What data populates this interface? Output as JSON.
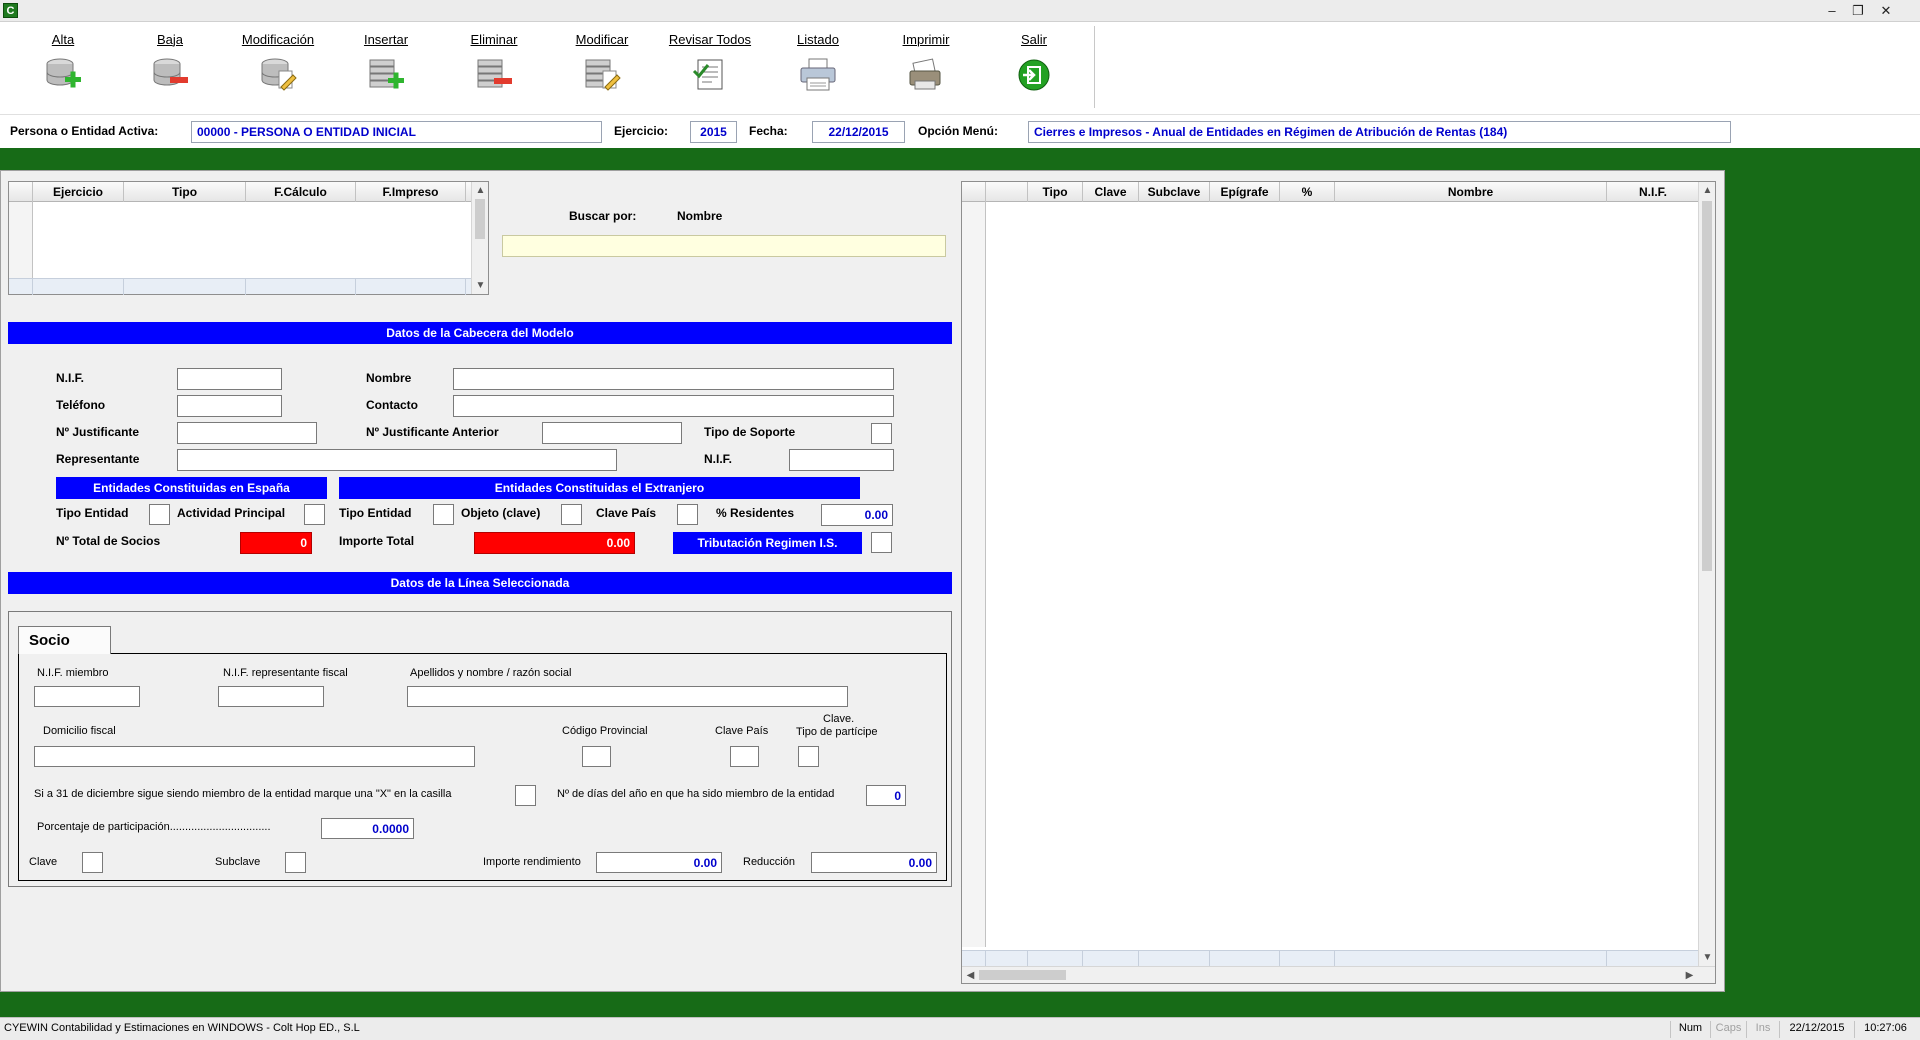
{
  "window": {
    "icon_letter": "C"
  },
  "toolbar": {
    "items": [
      {
        "label": "Alta",
        "icon": "db-add-icon"
      },
      {
        "label": "Baja",
        "icon": "db-remove-icon"
      },
      {
        "label": "Modificación",
        "icon": "db-edit-icon"
      },
      {
        "label": "Insertar",
        "icon": "stack-add-icon"
      },
      {
        "label": "Eliminar",
        "icon": "stack-remove-icon"
      },
      {
        "label": "Modificar",
        "icon": "stack-edit-icon"
      },
      {
        "label": "Revisar Todos",
        "icon": "review-icon"
      },
      {
        "label": "Listado",
        "icon": "printer-icon"
      },
      {
        "label": "Imprimir",
        "icon": "print-job-icon"
      },
      {
        "label": "Salir",
        "icon": "exit-icon"
      }
    ]
  },
  "active": {
    "persona_label": "Persona o Entidad Activa:",
    "persona_value": "00000 - PERSONA O ENTIDAD INICIAL",
    "ejercicio_label": "Ejercicio:",
    "ejercicio_value": "2015",
    "fecha_label": "Fecha:",
    "fecha_value": "22/12/2015",
    "opcion_label": "Opción Menú:",
    "opcion_value": "Cierres e Impresos - Anual de Entidades en Régimen de Atribución de Rentas (184)"
  },
  "left_grid": {
    "columns": [
      "Ejercicio",
      "Tipo",
      "F.Cálculo",
      "F.Impreso"
    ]
  },
  "search": {
    "label": "Buscar por:",
    "field_name": "Nombre",
    "value": ""
  },
  "right_grid": {
    "columns": [
      "Tipo",
      "Clave",
      "Subclave",
      "Epígrafe",
      "%",
      "Nombre",
      "N.I.F."
    ]
  },
  "cabecera": {
    "title": "Datos de la Cabecera del Modelo",
    "nif_label": "N.I.F.",
    "telefono_label": "Teléfono",
    "justificante_label": "Nº Justificante",
    "representante_label": "Representante",
    "nombre_label": "Nombre",
    "contacto_label": "Contacto",
    "justificante_ant_label": "Nº Justificante Anterior",
    "soporte_label": "Tipo de Soporte",
    "rep_nif_label": "N.I.F.",
    "espana_title": "Entidades Constituidas en España",
    "extranjero_title": "Entidades Constituidas el Extranjero",
    "tipo_entidad_label": "Tipo Entidad",
    "actividad_label": "Actividad Principal",
    "tipo_entidad2_label": "Tipo Entidad",
    "objeto_label": "Objeto (clave)",
    "clave_pais_label": "Clave País",
    "residentes_label": "% Residentes",
    "residentes_value": "0.00",
    "total_socios_label": "Nº Total de Socios",
    "total_socios_value": "0",
    "importe_total_label": "Importe Total",
    "importe_total_value": "0.00",
    "tributacion_label": "Tributación Regimen I.S."
  },
  "linea": {
    "title": "Datos de la Línea Seleccionada",
    "tab_label": "Socio",
    "nif_miembro_label": "N.I.F. miembro",
    "nif_rep_label": "N.I.F.  representante fiscal",
    "apellidos_label": "Apellidos y nombre / razón social",
    "domicilio_label": "Domicilio fiscal",
    "cod_prov_label": "Código Provincial",
    "clave_pais_label": "Clave País",
    "clave_tipo_line1": "Clave.",
    "clave_tipo_line2": "Tipo de partícipe",
    "miembro_text": "Si a 31 de diciembre sigue siendo miembro de la entidad marque una \"X\" en la casilla",
    "dias_label": "Nº de días del año en que ha sido miembro de la entidad",
    "dias_value": "0",
    "porcentaje_label": "Porcentaje de participación.................................",
    "porcentaje_value": "0.0000",
    "clave_label": "Clave",
    "subclave_label": "Subclave",
    "importe_label": "Importe rendimiento",
    "importe_value": "0.00",
    "reduccion_label": "Reducción",
    "reduccion_value": "0.00"
  },
  "status": {
    "app_text": "CYEWIN Contabilidad y Estimaciones en WINDOWS - Colt Hop ED., S.L",
    "num": "Num",
    "caps": "Caps",
    "ins": "Ins",
    "date": "22/12/2015",
    "time": "10:27:06"
  },
  "colors": {
    "frame_green": "#176b17",
    "header_blue": "#0000ff",
    "value_blue": "#0000cc",
    "alert_red": "#ff0000",
    "search_yellow": "#ffffe0"
  }
}
